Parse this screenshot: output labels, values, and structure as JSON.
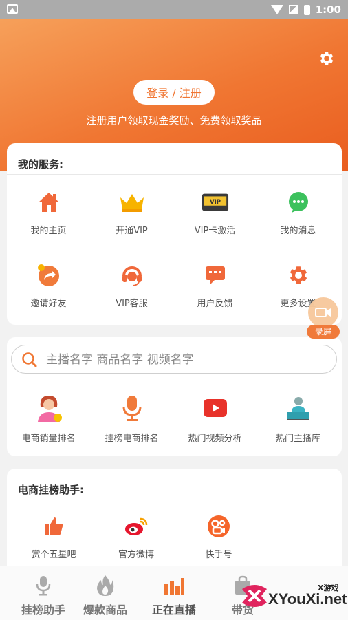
{
  "status_bar": {
    "time": "1:00"
  },
  "header": {
    "login_label": "登录 / 注册",
    "promo_text": "注册用户领取现金奖励、免费领取奖品"
  },
  "services": {
    "title": "我的服务:",
    "items": [
      {
        "label": "我的主页",
        "icon": "home-icon"
      },
      {
        "label": "开通VIP",
        "icon": "crown-icon"
      },
      {
        "label": "VIP卡激活",
        "icon": "vip-card-icon"
      },
      {
        "label": "我的消息",
        "icon": "message-icon"
      },
      {
        "label": "邀请好友",
        "icon": "share-icon"
      },
      {
        "label": "VIP客服",
        "icon": "headset-icon"
      },
      {
        "label": "用户反馈",
        "icon": "feedback-icon"
      },
      {
        "label": "更多设置",
        "icon": "settings-icon"
      }
    ]
  },
  "search": {
    "placeholder": "主播名字 商品名字 视频名字",
    "items": [
      {
        "label": "电商销量排名",
        "icon": "seller-avatar-icon"
      },
      {
        "label": "挂榜电商排名",
        "icon": "microphone-icon"
      },
      {
        "label": "热门视频分析",
        "icon": "video-play-icon"
      },
      {
        "label": "热门主播库",
        "icon": "anchor-icon"
      }
    ]
  },
  "assistant": {
    "title": "电商挂榜助手:",
    "items": [
      {
        "label": "赏个五星吧",
        "icon": "thumbs-up-icon"
      },
      {
        "label": "官方微博",
        "icon": "weibo-icon"
      },
      {
        "label": "快手号",
        "icon": "kuaishou-icon"
      }
    ]
  },
  "float_button": {
    "label": "录屏"
  },
  "tabbar": {
    "items": [
      {
        "label": "挂榜助手",
        "icon": "mic-tab-icon"
      },
      {
        "label": "爆款商品",
        "icon": "flame-tab-icon"
      },
      {
        "label": "正在直播",
        "icon": "bars-tab-icon"
      },
      {
        "label": "带货",
        "icon": "bag-tab-icon"
      }
    ]
  },
  "watermark": {
    "line1": "X游戏",
    "line2": "XYouXi.net"
  },
  "colors": {
    "accent": "#f07632",
    "header_start": "#f6a05a",
    "header_end": "#e95d1f"
  }
}
